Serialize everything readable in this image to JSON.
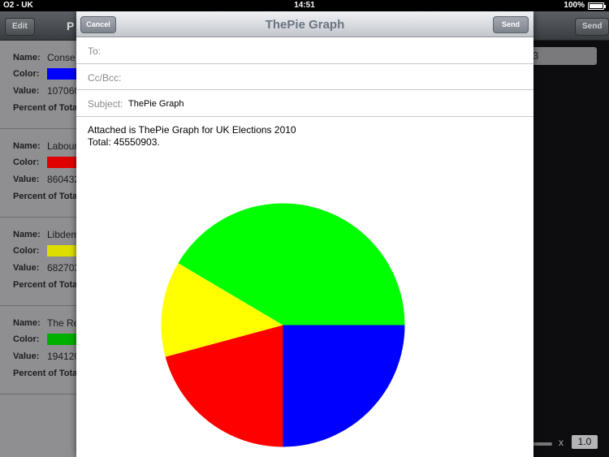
{
  "status": {
    "carrier": "O2 - UK",
    "time": "14:51",
    "battery": "100%"
  },
  "background": {
    "edit_label": "Edit",
    "title_fragment": "P",
    "send_label": "Send",
    "name_field_fragment": "3",
    "scale_x": "x",
    "scale_value": "1.0",
    "label_name": "Name:",
    "label_color": "Color:",
    "label_value": "Value:",
    "label_percent": "Percent of Tota",
    "rows": [
      {
        "name": "Conse",
        "color": "#0000ff",
        "value": "107060"
      },
      {
        "name": "Labour",
        "color": "#e00000",
        "value": "860432"
      },
      {
        "name": "Libdem",
        "color": "#dede00",
        "value": "682703"
      },
      {
        "name": "The Re",
        "color": "#00b000",
        "value": "194120"
      }
    ]
  },
  "email": {
    "cancel_label": "Cancel",
    "title": "ThePie Graph",
    "send_label": "Send",
    "to_label": "To:",
    "ccbcc_label": "Cc/Bcc:",
    "subject_label": "Subject:",
    "subject_value": "ThePie Graph",
    "body_line1": "Attached is ThePie Graph for UK Elections 2010",
    "body_line2": "Total: 45550903."
  },
  "chart_data": {
    "type": "pie",
    "slices": [
      {
        "color": "#0000ff",
        "percent": 25.0
      },
      {
        "color": "#ff0000",
        "percent": 20.8
      },
      {
        "color": "#ffff00",
        "percent": 12.7
      },
      {
        "color": "#00ff00",
        "percent": 41.5
      }
    ]
  }
}
